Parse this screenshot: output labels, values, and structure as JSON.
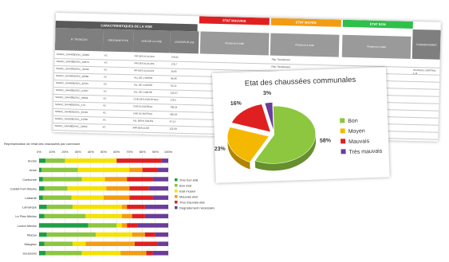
{
  "spreadsheet": {
    "group_headers": [
      "ETAT MAUVAIS",
      "ETAT MOYEN",
      "ETAT BON"
    ],
    "group_colors": [
      "#e02020",
      "#f39c12",
      "#2fbf4a"
    ],
    "section_title": "CARACTÉRISTIQUES DE LA VOIE",
    "columns": [
      "N° TRONÇON",
      "ORDONNÉ PTTE",
      "NOM DE LA VOIE",
      "LONGUEUR (ml)"
    ],
    "rows": [
      [
        "SANAC_SA4400DSVC_02669",
        "VC",
        "RP DES ACACIAS",
        "156,61"
      ],
      [
        "SANAC_SA4400DSVC_02672",
        "VC",
        "RP DES ACACIAS",
        "178,7"
      ],
      [
        "SANAC_SA4400DSVC_23158",
        "VC",
        "RP DES ACACIAS",
        "34,85"
      ],
      [
        "SANAC_SA4400DSVC_02366",
        "VC",
        "ALL DE L'AMITIE",
        "89,96"
      ],
      [
        "SANAC_SA4400DSVC_22375",
        "VC",
        "ALL DE L'AMITIE",
        "91,12"
      ],
      [
        "SANAC_SA4400DSVC_24787",
        "VC",
        "ALL DE L'AMITIE",
        "122,37"
      ],
      [
        "SANAC_SA4400DSVC_02991",
        "VC",
        "CHE DES AYELETTES",
        "176,5"
      ],
      [
        "SANAC_SA4400DSVC_173",
        "VC",
        "CHE DU BATEAU",
        "798,24"
      ],
      [
        "SANAC_SA4400DSVC_25193",
        "VC",
        "CHE DU BATEAU",
        "482,19"
      ],
      [
        "SANAC_SA4400DSVC_24788",
        "VC",
        "ALL BEAU SOLEIL",
        "87,14"
      ],
      [
        "SANAC_SA4400DSVC_22562",
        "VC",
        "IMP BEAUCHE",
        "122,48"
      ],
      [
        "SANAC_SA4400DSVC_19078",
        "VC",
        "R BOCHE",
        "84,38"
      ]
    ],
    "sub_headers": [
      "Plusieurs à totali",
      "Plusieurs à totali",
      "Plusieurs à totali"
    ],
    "side_note": "COMMENTAIRES",
    "row_notes": [
      "Rép. Revêtement",
      "Rép. Revêtement"
    ],
    "far_note": "PLATEAU CENTRAL L.O"
  },
  "pie_card": {
    "title": "Etat des chaussées communales",
    "legend": [
      "Bon",
      "Moyen",
      "Mauvais",
      "Très mauvais"
    ],
    "colors": [
      "#8dc63f",
      "#f5b800",
      "#e02020",
      "#6a3d9a"
    ]
  },
  "bar_card": {
    "title": "Représentation de l'état des chaussées par commune",
    "x_ticks": [
      "0%",
      "10%",
      "20%",
      "30%",
      "40%",
      "50%",
      "60%",
      "70%",
      "80%",
      "90%",
      "100%"
    ],
    "legend": [
      "Très bon état",
      "Bon état",
      "Etat moyen",
      "Mauvais état",
      "Très mauvais état",
      "Dégradement nécessaire"
    ],
    "legend_colors": [
      "#1f9e46",
      "#8dc63f",
      "#f5e200",
      "#f39c12",
      "#e02020",
      "#6a3d9a"
    ]
  },
  "chart_data": [
    {
      "type": "pie",
      "title": "Etat des chaussées communales",
      "categories": [
        "Bon",
        "Moyen",
        "Mauvais",
        "Très mauvais"
      ],
      "values": [
        58,
        23,
        16,
        3
      ],
      "unit": "%",
      "legend_position": "right"
    },
    {
      "type": "bar",
      "orientation": "horizontal",
      "stacked": true,
      "title": "Représentation de l'état des chaussées par commune",
      "categories": [
        "Arcins",
        "Anse",
        "Carbonne",
        "Castet-Fort-Wacko",
        "Labarde",
        "Lamarque",
        "Le Pian Médoc",
        "Ludon Médoc",
        "Macau",
        "Margaux",
        "Soussans"
      ],
      "xlim": [
        0,
        100
      ],
      "series": [
        {
          "name": "Très bon état",
          "values": [
            5,
            2,
            3,
            4,
            3,
            6,
            4,
            38,
            6,
            4,
            5
          ]
        },
        {
          "name": "Bon état",
          "values": [
            15,
            28,
            30,
            18,
            22,
            20,
            32,
            22,
            38,
            22,
            28
          ]
        },
        {
          "name": "Etat moyen",
          "values": [
            40,
            40,
            18,
            30,
            25,
            38,
            28,
            4,
            28,
            10,
            30
          ]
        },
        {
          "name": "Mauvais état",
          "values": [
            0,
            10,
            17,
            18,
            20,
            4,
            8,
            4,
            10,
            38,
            20
          ]
        },
        {
          "name": "Très mauvais état",
          "values": [
            35,
            12,
            20,
            15,
            18,
            14,
            10,
            8,
            8,
            18,
            5
          ]
        },
        {
          "name": "Dégradement nécessaire",
          "values": [
            5,
            8,
            12,
            15,
            12,
            18,
            18,
            24,
            10,
            8,
            12
          ]
        }
      ],
      "legend_position": "right"
    }
  ]
}
